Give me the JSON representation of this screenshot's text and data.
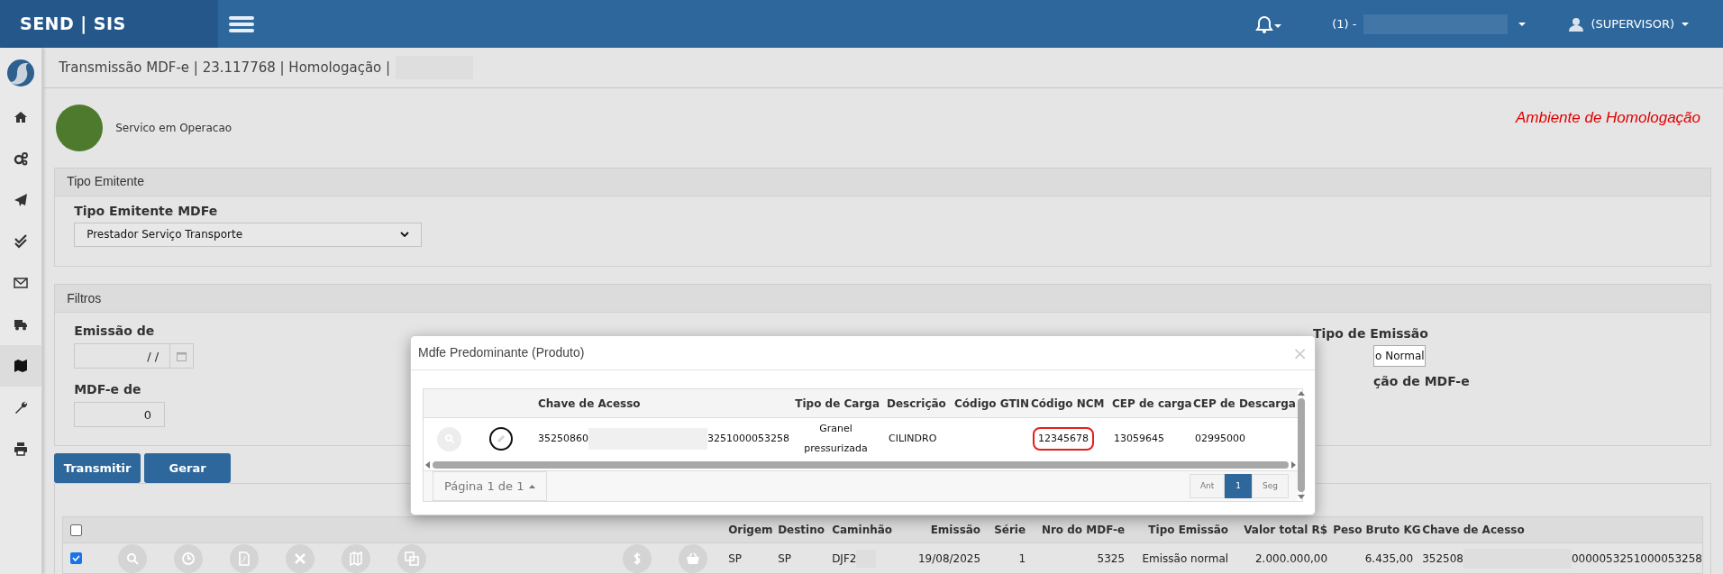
{
  "topbar": {
    "brand": "SEND | SIS",
    "company": "(1) -",
    "user": "(SUPERVISOR)"
  },
  "sidebar": {
    "items": [
      {
        "kind": "home",
        "selected": false
      },
      {
        "kind": "cogs",
        "selected": false
      },
      {
        "kind": "plane",
        "selected": false
      },
      {
        "kind": "checks",
        "selected": false
      },
      {
        "kind": "mail",
        "selected": false
      },
      {
        "kind": "truck",
        "selected": false
      },
      {
        "kind": "map",
        "selected": true
      },
      {
        "kind": "wrench",
        "selected": false
      },
      {
        "kind": "print",
        "selected": false
      }
    ]
  },
  "breadcrumb": "Transmissão MDF-e | 23.117768 | Homologação |",
  "service_status": {
    "text": "Servico em Operacao",
    "color": "#4e7a2e"
  },
  "environment_label": "Ambiente de Homologação",
  "tipo_emitente": {
    "title": "Tipo Emitente",
    "label": "Tipo Emitente MDFe",
    "value": "Prestador Serviço Transporte"
  },
  "filtros": {
    "title": "Filtros",
    "emissao_de": {
      "label": "Emissão de",
      "value": "  / /"
    },
    "mdfe_de": {
      "label": "MDF-e de",
      "value": "0"
    },
    "tipo_emissao": {
      "label": "Tipo de Emissão",
      "value": "o Normal"
    },
    "situacao_label": "ção de MDF-e"
  },
  "buttons": [
    "Transmitir",
    "Gerar"
  ],
  "table": {
    "header_checked": false,
    "columns": [
      "Origem",
      "Destino",
      "Caminhão",
      "Emissão",
      "Série",
      "Nro do MDF-e",
      "Tipo Emissão",
      "Valor total R$",
      "Peso Bruto KG",
      "Chave de Acesso"
    ],
    "rows": [
      {
        "checked": true,
        "actions": [
          {
            "kind": "search"
          },
          {
            "kind": "clock"
          },
          {
            "kind": "pdf"
          },
          {
            "kind": "close"
          },
          {
            "kind": "map"
          },
          {
            "kind": "copy"
          },
          {
            "kind": "dollar"
          },
          {
            "kind": "basket"
          }
        ],
        "cells": [
          "SP",
          "SP",
          "DJF2",
          "19/08/2025",
          "1",
          "5325",
          "Emissão normal",
          "2.000.000,00",
          "6.435,00"
        ],
        "chave_start": "352508",
        "chave_end": "0000053251000053258"
      }
    ]
  },
  "modal": {
    "title": "Mdfe Predominante (Produto)",
    "close": "×",
    "columns": [
      "Chave de Acesso",
      "Tipo de Carga",
      "Descrição",
      "Código GTIN",
      "Código NCM",
      "CEP de carga",
      "CEP de Descarga"
    ],
    "rows": [
      {
        "chave_start": "35250860",
        "chave_end": "3251000053258",
        "tipo_carga": "Granel pressurizada",
        "descricao": "CILINDRO",
        "codigo_ncm": "12345678",
        "ncm_highlighted": true,
        "cep_carga": "13059645",
        "cep_descarga": "02995000"
      }
    ],
    "pager": {
      "label": "Página 1 de 1",
      "pages": [
        {
          "label": "Ant",
          "selected": false
        },
        {
          "label": "1",
          "selected": true
        },
        {
          "label": "Seg",
          "selected": false
        }
      ]
    }
  }
}
